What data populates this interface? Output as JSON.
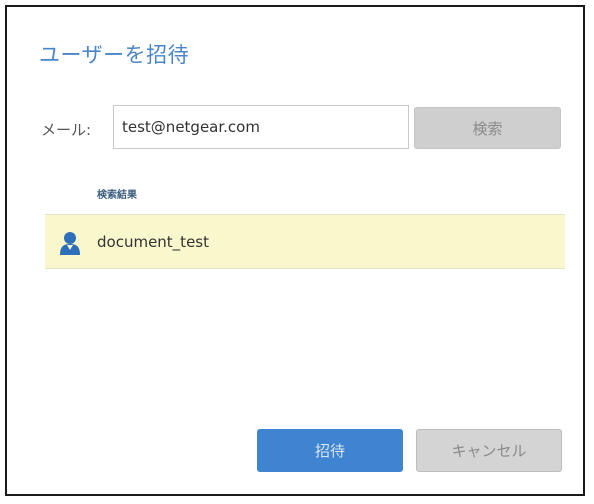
{
  "dialog": {
    "title": "ユーザーを招待",
    "email_label": "メール:",
    "email_value": "test@netgear.com",
    "search_label": "検索",
    "results_heading": "検索結果",
    "results": [
      {
        "name": "document_test",
        "icon": "user-icon",
        "selected": true
      }
    ],
    "invite_label": "招待",
    "cancel_label": "キャンセル"
  },
  "colors": {
    "title": "#4a86c8",
    "selected_row": "#f9f7cc",
    "primary_button": "#3e84d0",
    "secondary_button": "#d4d4d4"
  }
}
